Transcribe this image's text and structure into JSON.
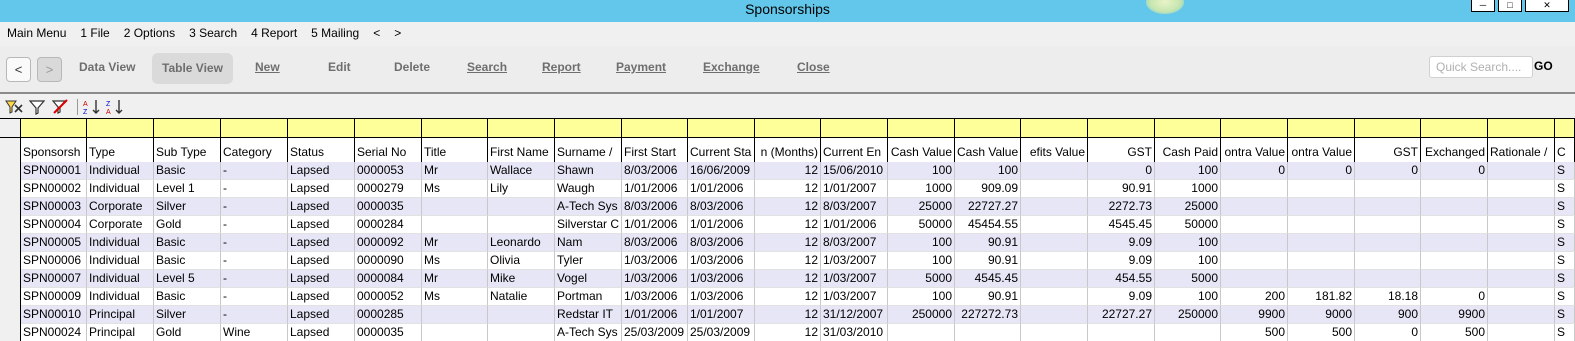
{
  "window": {
    "title": "Sponsorships"
  },
  "menu": [
    "Main Menu",
    "1 File",
    "2 Options",
    "3 Search",
    "4 Report",
    "5 Mailing",
    "<",
    ">"
  ],
  "toolbar": {
    "back": "<",
    "forward": ">",
    "data_view": "Data View",
    "table_view": "Table View",
    "new": "New",
    "edit": "Edit",
    "delete": "Delete",
    "search": "Search",
    "report": "Report",
    "payment": "Payment",
    "exchange": "Exchange",
    "close": "Close",
    "quick_search_placeholder": "Quick Search....",
    "go": "GO"
  },
  "icons": [
    "filter-clear-icon",
    "filter-icon",
    "filter-remove-icon",
    "sort-ascending-icon",
    "sort-descending-icon"
  ],
  "table": {
    "columns": [
      {
        "label": "Sponsorsh",
        "align": "left"
      },
      {
        "label": "Type",
        "align": "left"
      },
      {
        "label": "Sub Type",
        "align": "left"
      },
      {
        "label": "Category",
        "align": "left"
      },
      {
        "label": "Status",
        "align": "left"
      },
      {
        "label": "Serial No",
        "align": "left"
      },
      {
        "label": "Title",
        "align": "left"
      },
      {
        "label": "First Name",
        "align": "left"
      },
      {
        "label": "Surname /",
        "align": "left"
      },
      {
        "label": "First Start",
        "align": "left"
      },
      {
        "label": "Current Sta",
        "align": "left"
      },
      {
        "label": "n (Months)",
        "align": "right"
      },
      {
        "label": "Current En",
        "align": "left"
      },
      {
        "label": "Cash Value",
        "align": "right"
      },
      {
        "label": "Cash Value",
        "align": "right"
      },
      {
        "label": "efits Value",
        "align": "right"
      },
      {
        "label": "GST",
        "align": "right"
      },
      {
        "label": "Cash Paid",
        "align": "right"
      },
      {
        "label": "ontra Value",
        "align": "right"
      },
      {
        "label": "ontra Value",
        "align": "right"
      },
      {
        "label": "GST",
        "align": "right"
      },
      {
        "label": "Exchanged",
        "align": "right"
      },
      {
        "label": "Rationale /",
        "align": "left"
      },
      {
        "label": "C",
        "align": "left"
      }
    ],
    "rows": [
      [
        "SPN00001",
        "Individual",
        "Basic",
        "-",
        "Lapsed",
        "0000053",
        "Mr",
        "Wallace",
        "Shawn",
        "8/03/2006",
        "16/06/2009",
        "12",
        "15/06/2010",
        "100",
        "100",
        "",
        "0",
        "100",
        "0",
        "0",
        "0",
        "0",
        "",
        "S"
      ],
      [
        "SPN00002",
        "Individual",
        "Level 1",
        "-",
        "Lapsed",
        "0000279",
        "Ms",
        "Lily",
        "Waugh",
        "1/01/2006",
        "1/01/2006",
        "12",
        "1/01/2007",
        "1000",
        "909.09",
        "",
        "90.91",
        "1000",
        "",
        "",
        "",
        "",
        "",
        "S"
      ],
      [
        "SPN00003",
        "Corporate",
        "Silver",
        "-",
        "Lapsed",
        "0000035",
        "",
        "",
        "A-Tech Sys",
        "8/03/2006",
        "8/03/2006",
        "12",
        "8/03/2007",
        "25000",
        "22727.27",
        "",
        "2272.73",
        "25000",
        "",
        "",
        "",
        "",
        "",
        "S"
      ],
      [
        "SPN00004",
        "Corporate",
        "Gold",
        "-",
        "Lapsed",
        "0000284",
        "",
        "",
        "Silverstar C",
        "1/01/2006",
        "1/01/2006",
        "12",
        "1/01/2006",
        "50000",
        "45454.55",
        "",
        "4545.45",
        "50000",
        "",
        "",
        "",
        "",
        "",
        "S"
      ],
      [
        "SPN00005",
        "Individual",
        "Basic",
        "-",
        "Lapsed",
        "0000092",
        "Mr",
        "Leonardo",
        "Nam",
        "8/03/2006",
        "8/03/2006",
        "12",
        "8/03/2007",
        "100",
        "90.91",
        "",
        "9.09",
        "100",
        "",
        "",
        "",
        "",
        "",
        "S"
      ],
      [
        "SPN00006",
        "Individual",
        "Basic",
        "-",
        "Lapsed",
        "0000090",
        "Ms",
        "Olivia",
        "Tyler",
        "1/03/2006",
        "1/03/2006",
        "12",
        "1/03/2007",
        "100",
        "90.91",
        "",
        "9.09",
        "100",
        "",
        "",
        "",
        "",
        "",
        "S"
      ],
      [
        "SPN00007",
        "Individual",
        "Level 5",
        "-",
        "Lapsed",
        "0000084",
        "Mr",
        "Mike",
        "Vogel",
        "1/03/2006",
        "1/03/2006",
        "12",
        "1/03/2007",
        "5000",
        "4545.45",
        "",
        "454.55",
        "5000",
        "",
        "",
        "",
        "",
        "",
        "S"
      ],
      [
        "SPN00009",
        "Individual",
        "Basic",
        "-",
        "Lapsed",
        "0000052",
        "Ms",
        "Natalie",
        "Portman",
        "1/03/2006",
        "1/03/2006",
        "12",
        "1/03/2007",
        "100",
        "90.91",
        "",
        "9.09",
        "100",
        "200",
        "181.82",
        "18.18",
        "0",
        "",
        "S"
      ],
      [
        "SPN00010",
        "Principal",
        "Silver",
        "-",
        "Lapsed",
        "0000285",
        "",
        "",
        "Redstar IT",
        "1/01/2006",
        "1/01/2007",
        "12",
        "31/12/2007",
        "250000",
        "227272.73",
        "",
        "22727.27",
        "250000",
        "9900",
        "9000",
        "900",
        "9900",
        "",
        "S"
      ],
      [
        "SPN00024",
        "Principal",
        "Gold",
        "Wine",
        "Lapsed",
        "0000035",
        "",
        "",
        "A-Tech Sys",
        "25/03/2009",
        "25/03/2009",
        "12",
        "31/03/2010",
        "",
        "",
        "",
        "",
        "",
        "500",
        "500",
        "0",
        "500",
        "",
        "S"
      ]
    ]
  }
}
